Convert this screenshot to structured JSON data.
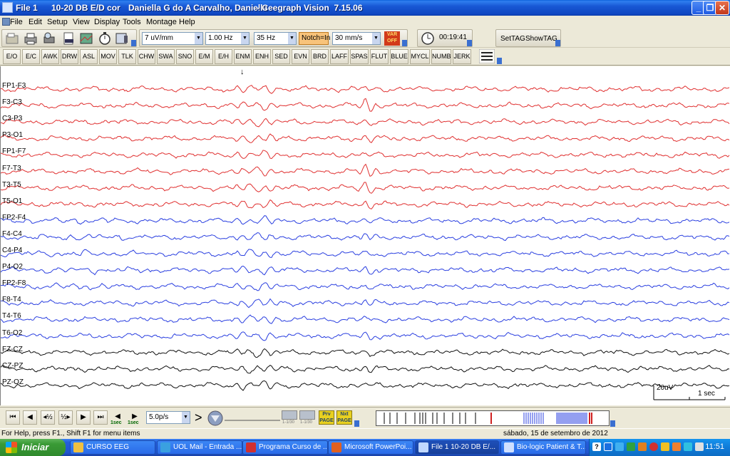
{
  "window": {
    "file": "File 1",
    "montage": "10-20 DB E/D cor",
    "patient": "Daniella G do A Carvalho, Daniella",
    "app": "- Ceegraph Vision  7.15.06",
    "controls": {
      "minimize": "_",
      "restore": "❐",
      "close": "✕"
    }
  },
  "menu": [
    "File",
    "Edit",
    "Setup",
    "View",
    "Display",
    "Tools",
    "Montage",
    "Help"
  ],
  "toolbar": {
    "sensitivity": "7 uV/mm",
    "low_filter": "1.00 Hz",
    "high_filter": "35 Hz",
    "notch": "Notch=In",
    "paper_speed": "30 mm/s",
    "var_label": "VAR OFF",
    "elapsed_time": "00:19:41",
    "set_tag": "SetTAG",
    "show_tag": "ShowTAG"
  },
  "events": [
    "E/O",
    "E/C",
    "AWK",
    "DRW",
    "ASL",
    "MOV",
    "TLK",
    "CHW",
    "SWA",
    "SNO",
    "E/M",
    "E/H",
    "ENM",
    "ENH",
    "SED",
    "EVN",
    "BRD",
    "LAFF",
    "SPAS",
    "FLUT",
    "BLUE",
    "MYCL",
    "NUMB",
    "JERK"
  ],
  "marker_arrow": "↓",
  "channels": [
    {
      "label": "FP1-F3",
      "color": "#e03030"
    },
    {
      "label": "F3-C3",
      "color": "#e03030"
    },
    {
      "label": "C3-P3",
      "color": "#e03030"
    },
    {
      "label": "P3-O1",
      "color": "#e03030"
    },
    {
      "label": "FP1-F7",
      "color": "#e03030"
    },
    {
      "label": "F7-T3",
      "color": "#e03030"
    },
    {
      "label": "T3-T5",
      "color": "#e03030"
    },
    {
      "label": "T5-O1",
      "color": "#e03030"
    },
    {
      "label": "FP2-F4",
      "color": "#2a3fe0"
    },
    {
      "label": "F4-C4",
      "color": "#2a3fe0"
    },
    {
      "label": "C4-P4",
      "color": "#2a3fe0"
    },
    {
      "label": "P4-O2",
      "color": "#2a3fe0"
    },
    {
      "label": "FP2-F8",
      "color": "#2a3fe0"
    },
    {
      "label": "F8-T4",
      "color": "#2a3fe0"
    },
    {
      "label": "T4-T6",
      "color": "#2a3fe0"
    },
    {
      "label": "T6-O2",
      "color": "#2a3fe0"
    },
    {
      "label": "FZ-CZ",
      "color": "#101010"
    },
    {
      "label": "CZ-PZ",
      "color": "#101010"
    },
    {
      "label": "PZ-OZ",
      "color": "#101010"
    }
  ],
  "calibration": {
    "amplitude": "20uV",
    "time": "1 sec"
  },
  "nav": {
    "speed": "5.0p/s",
    "sec_left": "1sec",
    "sec_right": "1sec",
    "small_labels": [
      "1-1/30",
      "1-1/30"
    ],
    "prv_label": "Prv PAGE",
    "nxt_label": "Nxt PAGE"
  },
  "status": {
    "help": "For Help, press F1., Shift F1 for menu items",
    "date": "sábado, 15 de setembro de 2012"
  },
  "taskbar": {
    "start": "Iniciar",
    "tasks": [
      {
        "label": "CURSO EEG",
        "icon_color": "#f0c040"
      },
      {
        "label": "UOL Mail - Entrada ...",
        "icon_color": "#3aa0e0"
      },
      {
        "label": "Programa Curso de ...",
        "icon_color": "#d03030"
      },
      {
        "label": "Microsoft PowerPoi...",
        "icon_color": "#e06020"
      },
      {
        "label": "File 1   10-20 DB E/...",
        "icon_color": "#c0d8ff"
      },
      {
        "label": "Bio-logic Patient & T...",
        "icon_color": "#d0e0ff"
      }
    ],
    "clock": "11:51"
  }
}
